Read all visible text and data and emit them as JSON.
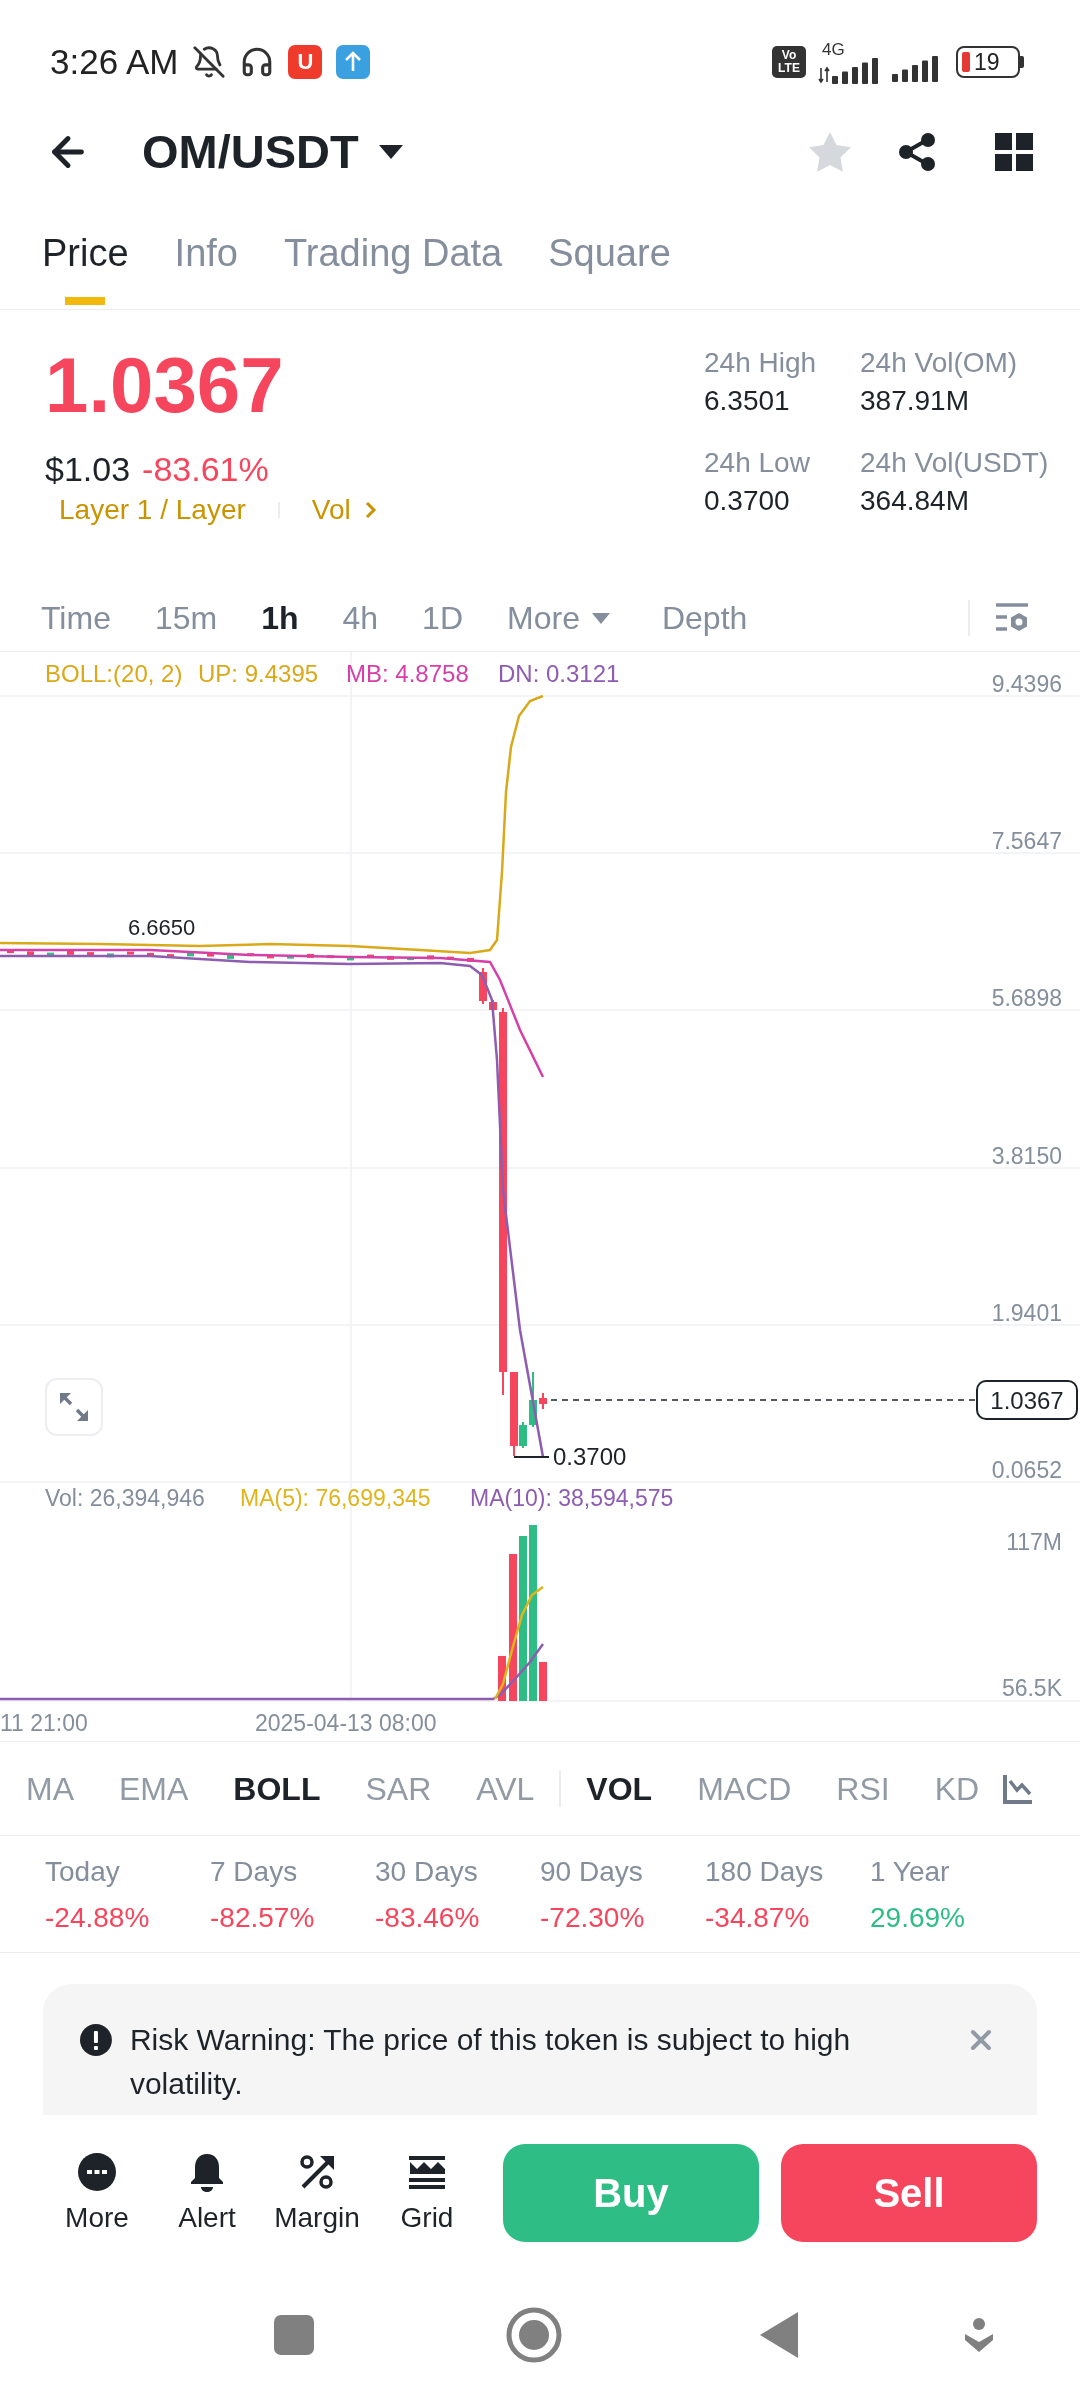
{
  "status_bar": {
    "time": "3:26 AM",
    "app_badge": "U",
    "volte": [
      "Vo",
      "LTE"
    ],
    "network": "4G",
    "battery": "19"
  },
  "header": {
    "title": "OM/USDT",
    "favorite": false
  },
  "tabs": [
    {
      "label": "Price",
      "selected": true
    },
    {
      "label": "Info",
      "selected": false
    },
    {
      "label": "Trading Data",
      "selected": false
    },
    {
      "label": "Square",
      "selected": false
    }
  ],
  "ticker": {
    "price": "1.0367",
    "usd_price": "$1.03",
    "change": "-83.61%",
    "negative": true,
    "tags": [
      "Layer 1 / Layer",
      "Vol"
    ]
  },
  "stats": [
    {
      "label": "24h High",
      "value": "6.3501"
    },
    {
      "label": "24h Vol(OM)",
      "value": "387.91M"
    },
    {
      "label": "24h Low",
      "value": "0.3700"
    },
    {
      "label": "24h Vol(USDT)",
      "value": "364.84M"
    }
  ],
  "intervals": [
    {
      "label": "Time",
      "kind": "interval",
      "selected": false
    },
    {
      "label": "15m",
      "kind": "interval",
      "selected": false
    },
    {
      "label": "1h",
      "kind": "interval",
      "selected": true
    },
    {
      "label": "4h",
      "kind": "interval",
      "selected": false
    },
    {
      "label": "1D",
      "kind": "interval",
      "selected": false
    },
    {
      "label": "More",
      "kind": "menu",
      "selected": false
    },
    {
      "label": "Depth",
      "kind": "view",
      "selected": false
    }
  ],
  "price_chart": {
    "legend": [
      {
        "text": "BOLL:(20, 2)",
        "color": "#d9a91a"
      },
      {
        "text": "UP: 9.4395",
        "color": "#d9a91a"
      },
      {
        "text": "MB: 4.8758",
        "color": "#d63fa8"
      },
      {
        "text": "DN: 0.3121",
        "color": "#8e5cb0"
      }
    ],
    "y_labels": [
      "9.4396",
      "7.5647",
      "5.6898",
      "3.8150",
      "1.9401",
      "0.0652"
    ],
    "high_marker": "6.6650",
    "low_marker": "0.3700",
    "last_price": "1.0367"
  },
  "volume_chart": {
    "legend": [
      {
        "text": "Vol: 26,394,946",
        "color": "#848e9c"
      },
      {
        "text": "MA(5): 76,699,345",
        "color": "#e0b41a"
      },
      {
        "text": "MA(10): 38,594,575",
        "color": "#8e5cb0"
      }
    ],
    "y_labels": [
      "117M",
      "56.5K"
    ],
    "x_labels": [
      "11 21:00",
      "2025-04-13 08:00"
    ]
  },
  "overlay_indicators": [
    {
      "label": "MA",
      "selected": false
    },
    {
      "label": "EMA",
      "selected": false
    },
    {
      "label": "BOLL",
      "selected": true
    },
    {
      "label": "SAR",
      "selected": false
    },
    {
      "label": "AVL",
      "selected": false
    }
  ],
  "panel_indicators": [
    {
      "label": "VOL",
      "selected": true
    },
    {
      "label": "MACD",
      "selected": false
    },
    {
      "label": "RSI",
      "selected": false
    },
    {
      "label": "KD",
      "selected": false
    }
  ],
  "performance": [
    {
      "label": "Today",
      "value": "-24.88%",
      "negative": true
    },
    {
      "label": "7 Days",
      "value": "-82.57%",
      "negative": true
    },
    {
      "label": "30 Days",
      "value": "-83.46%",
      "negative": true
    },
    {
      "label": "90 Days",
      "value": "-72.30%",
      "negative": true
    },
    {
      "label": "180 Days",
      "value": "-34.87%",
      "negative": true
    },
    {
      "label": "1 Year",
      "value": "29.69%",
      "negative": false
    }
  ],
  "risk_warning": {
    "text": "Risk Warning: The price of this token is subject to high volatility."
  },
  "tools": [
    {
      "label": "More",
      "kind": "more"
    },
    {
      "label": "Alert",
      "kind": "alert"
    },
    {
      "label": "Margin",
      "kind": "margin"
    },
    {
      "label": "Grid",
      "kind": "grid"
    }
  ],
  "trade_buttons": [
    {
      "label": "Buy",
      "kind": "buy"
    },
    {
      "label": "Sell",
      "kind": "sell"
    }
  ]
}
